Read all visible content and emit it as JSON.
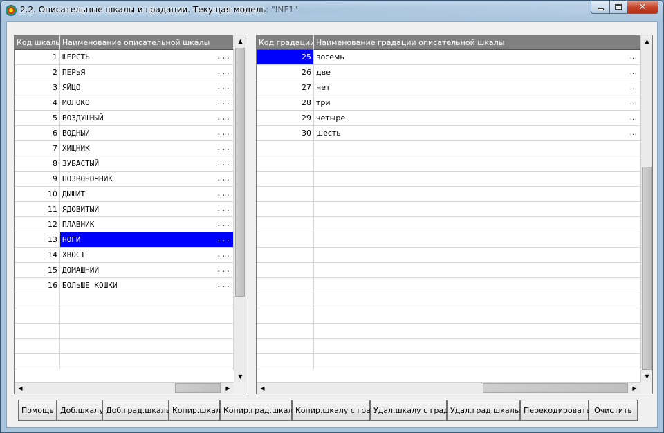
{
  "window": {
    "title": "2.2. Описательные шкалы и градации. Текущая модель: \"INF1\"",
    "close_glyph": "✕"
  },
  "scales_grid": {
    "headers": [
      "Код шкалы",
      "Наименование описательной шкалы"
    ],
    "rows": [
      {
        "code": "1",
        "name": "ШЕРСТЬ",
        "dots": "..."
      },
      {
        "code": "2",
        "name": "ПЕРЬЯ",
        "dots": "..."
      },
      {
        "code": "3",
        "name": "ЯЙЦО",
        "dots": "..."
      },
      {
        "code": "4",
        "name": "МОЛОКО",
        "dots": "..."
      },
      {
        "code": "5",
        "name": "ВОЗДУШНЫЙ",
        "dots": "..."
      },
      {
        "code": "6",
        "name": "ВОДНЫЙ",
        "dots": "..."
      },
      {
        "code": "7",
        "name": "ХИЩНИК",
        "dots": "..."
      },
      {
        "code": "8",
        "name": "ЗУБАСТЫЙ",
        "dots": "..."
      },
      {
        "code": "9",
        "name": "ПОЗВОНОЧНИК",
        "dots": "..."
      },
      {
        "code": "10",
        "name": "ДЫШИТ",
        "dots": "..."
      },
      {
        "code": "11",
        "name": "ЯДОВИТЫЙ",
        "dots": "..."
      },
      {
        "code": "12",
        "name": "ПЛАВНИК",
        "dots": "..."
      },
      {
        "code": "13",
        "name": "НОГИ",
        "dots": "..."
      },
      {
        "code": "14",
        "name": "ХВОСТ",
        "dots": "..."
      },
      {
        "code": "15",
        "name": "ДОМАШНИЙ",
        "dots": "..."
      },
      {
        "code": "16",
        "name": "БОЛЬШЕ КОШКИ",
        "dots": "..."
      }
    ],
    "selected_row": 12,
    "total_rows": 21
  },
  "gradations_grid": {
    "headers": [
      "Код градации",
      "Наименование градации описательной шкалы"
    ],
    "rows": [
      {
        "code": "25",
        "name": "восемь",
        "dots": "..."
      },
      {
        "code": "26",
        "name": "две",
        "dots": "..."
      },
      {
        "code": "27",
        "name": "нет",
        "dots": "..."
      },
      {
        "code": "28",
        "name": "три",
        "dots": "..."
      },
      {
        "code": "29",
        "name": "четыре",
        "dots": "..."
      },
      {
        "code": "30",
        "name": "шесть",
        "dots": "..."
      }
    ],
    "selected_row": 0,
    "total_rows": 21
  },
  "buttons": {
    "help": "Помощь",
    "add_scale": "Доб.шкалу",
    "add_grad": "Доб.град.шкалы",
    "copy_scale": "Копир.шкалу",
    "copy_grad": "Копир.град.шкалы",
    "copy_scale_with_grad": "Копир.шкалу с град.",
    "del_scale_with_grad": "Удал.шкалу с град.",
    "del_grad": "Удал.град.шкалы",
    "recode": "Перекодировать",
    "clear": "Очистить"
  },
  "colors": {
    "selection": "#0000ff",
    "header_bg": "#808080"
  }
}
